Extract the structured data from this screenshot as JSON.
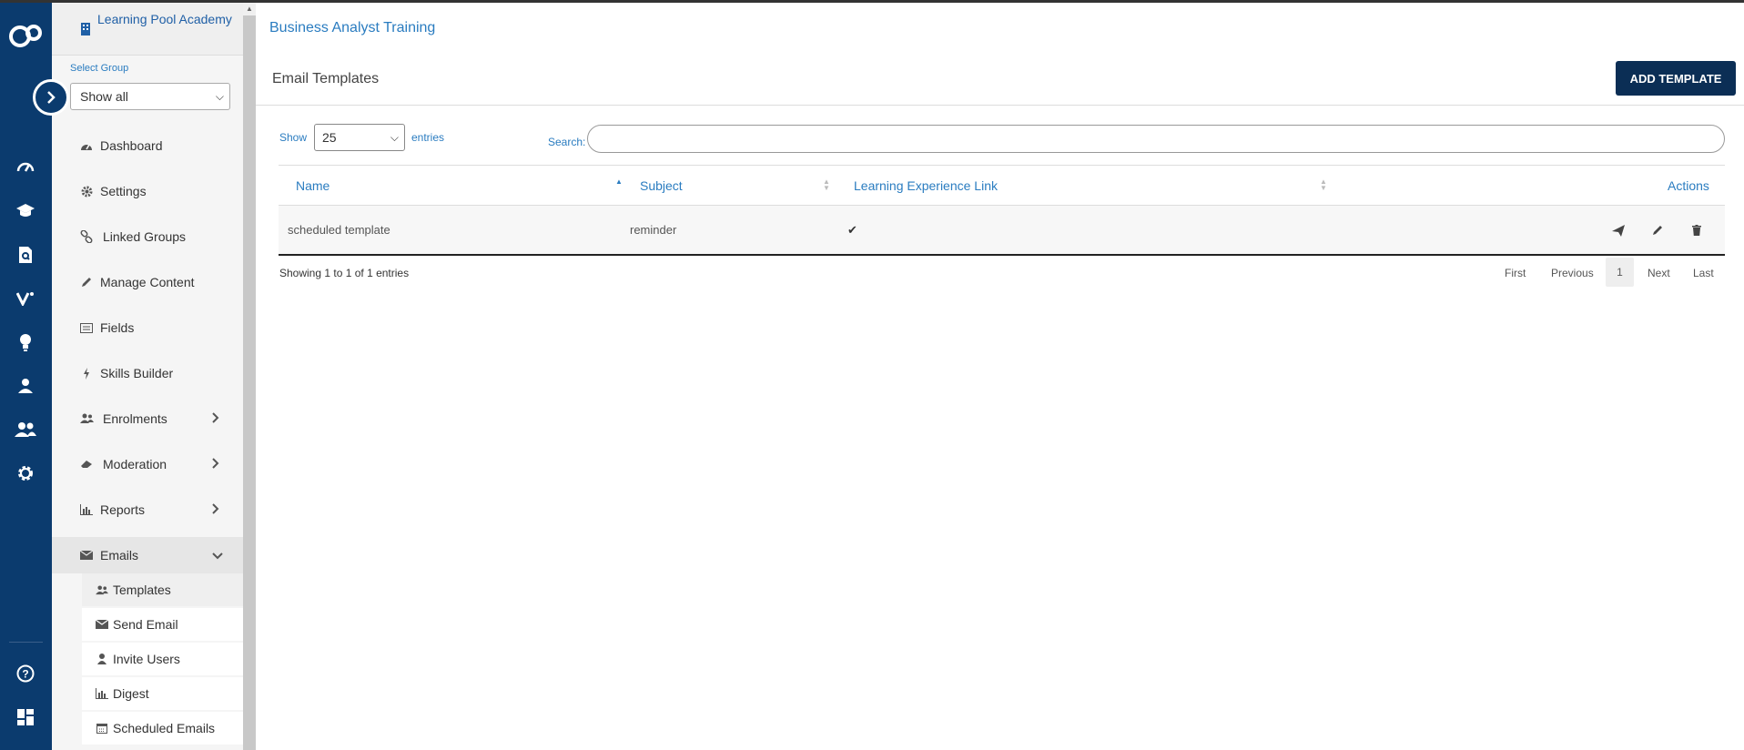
{
  "sidebar": {
    "academy_title": "Learning Pool Academy",
    "select_group_label": "Select Group",
    "select_group_value": "Show all",
    "items": [
      {
        "label": "Dashboard",
        "icon": "dashboard-icon"
      },
      {
        "label": "Settings",
        "icon": "gear-icon"
      },
      {
        "label": "Linked Groups",
        "icon": "link-icon"
      },
      {
        "label": "Manage Content",
        "icon": "pencil-icon"
      },
      {
        "label": "Fields",
        "icon": "list-icon"
      },
      {
        "label": "Skills Builder",
        "icon": "bolt-icon"
      },
      {
        "label": "Enrolments",
        "icon": "users-icon"
      },
      {
        "label": "Moderation",
        "icon": "eraser-icon"
      },
      {
        "label": "Reports",
        "icon": "bar-chart-icon"
      },
      {
        "label": "Emails",
        "icon": "envelope-icon"
      }
    ],
    "email_sub_items": [
      {
        "label": "Templates",
        "icon": "users-icon"
      },
      {
        "label": "Send Email",
        "icon": "envelope-icon"
      },
      {
        "label": "Invite Users",
        "icon": "user-icon"
      },
      {
        "label": "Digest",
        "icon": "bar-chart-icon"
      },
      {
        "label": "Scheduled Emails",
        "icon": "calendar-icon"
      }
    ]
  },
  "main": {
    "breadcrumb": "Business Analyst Training",
    "section_title": "Email Templates",
    "add_button": "ADD TEMPLATE",
    "show_label": "Show",
    "page_length": "25",
    "entries_label": "entries",
    "search_label": "Search:",
    "columns": [
      "Name",
      "Subject",
      "Learning Experience Link",
      "Actions"
    ],
    "rows": [
      {
        "name": "scheduled template",
        "subject": "reminder",
        "link": "✔"
      }
    ],
    "info": "Showing 1 to 1 of 1 entries",
    "pagination": {
      "first": "First",
      "previous": "Previous",
      "current": "1",
      "next": "Next",
      "last": "Last"
    }
  },
  "colors": {
    "rail": "#0b3b6e",
    "accent": "#2a7cc0",
    "button": "#0b2e55"
  }
}
